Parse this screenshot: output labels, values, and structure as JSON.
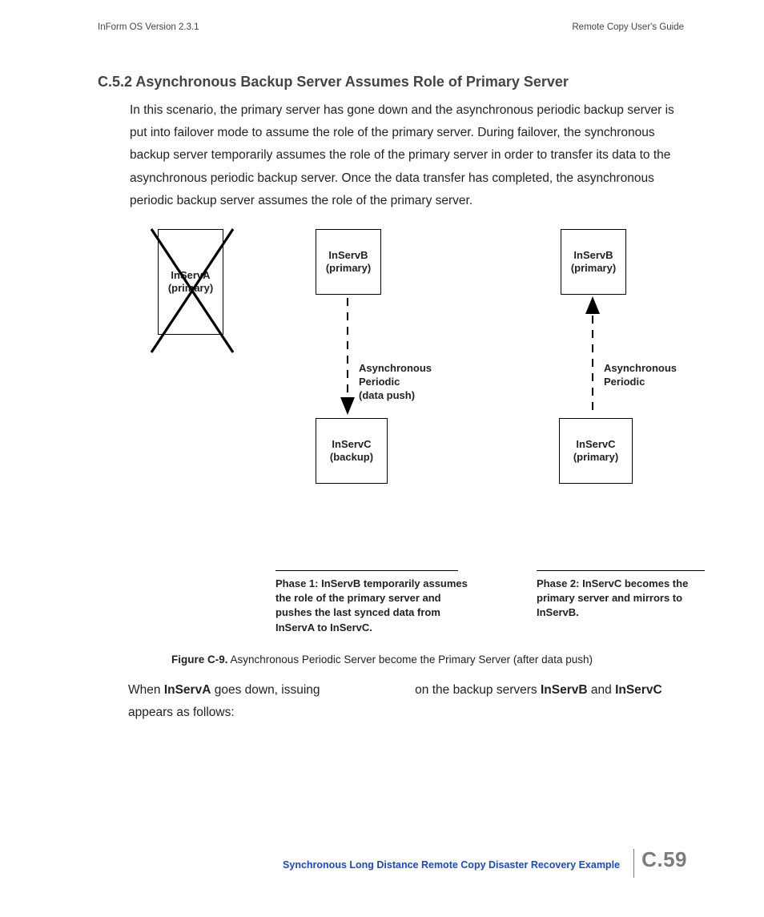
{
  "header": {
    "left": "InForm OS Version 2.3.1",
    "right": "Remote Copy User's Guide"
  },
  "section": {
    "heading": "C.5.2 Asynchronous Backup Server Assumes Role of Primary Server",
    "paragraph": "In this scenario, the primary server has gone down and the asynchronous periodic backup server is put into failover mode to assume the role of the primary server. During failover, the synchronous backup server temporarily assumes the role of the primary server in order to transfer its data to the asynchronous periodic backup server. Once the data transfer has completed, the asynchronous periodic backup server assumes the role of the primary server."
  },
  "figure": {
    "boxA_line1": "InServA",
    "boxA_line2": "(primary)",
    "boxB1_line1": "InServB",
    "boxB1_line2": "(primary)",
    "boxC1_line1": "InServC",
    "boxC1_line2": "(backup)",
    "label1_line1": "Asynchronous",
    "label1_line2": "Periodic",
    "label1_line3": "(data push)",
    "boxB2_line1": "InServB",
    "boxB2_line2": "(primary)",
    "boxC2_line1": "InServC",
    "boxC2_line2": "(primary)",
    "label2_line1": "Asynchronous",
    "label2_line2": "Periodic",
    "phase1": "Phase 1: InServB temporarily assumes the role of the primary server and pushes the last synced data from InServA to InServC.",
    "phase2": "Phase 2: InServC becomes the primary server and mirrors to InServB.",
    "caption_label": "Figure C-9.",
    "caption_text": "  Asynchronous Periodic Server become the Primary Server (after data push)"
  },
  "after": {
    "t1": "When ",
    "b1": "InServA",
    "t2": " goes down, issuing ",
    "gap": "",
    "t3": " on the backup servers ",
    "b2": "InServB",
    "t4": " and ",
    "b3": "InServC",
    "t5": " appears as follows:"
  },
  "footer": {
    "link": "Synchronous Long Distance Remote Copy Disaster Recovery Example",
    "page": "C.59"
  }
}
